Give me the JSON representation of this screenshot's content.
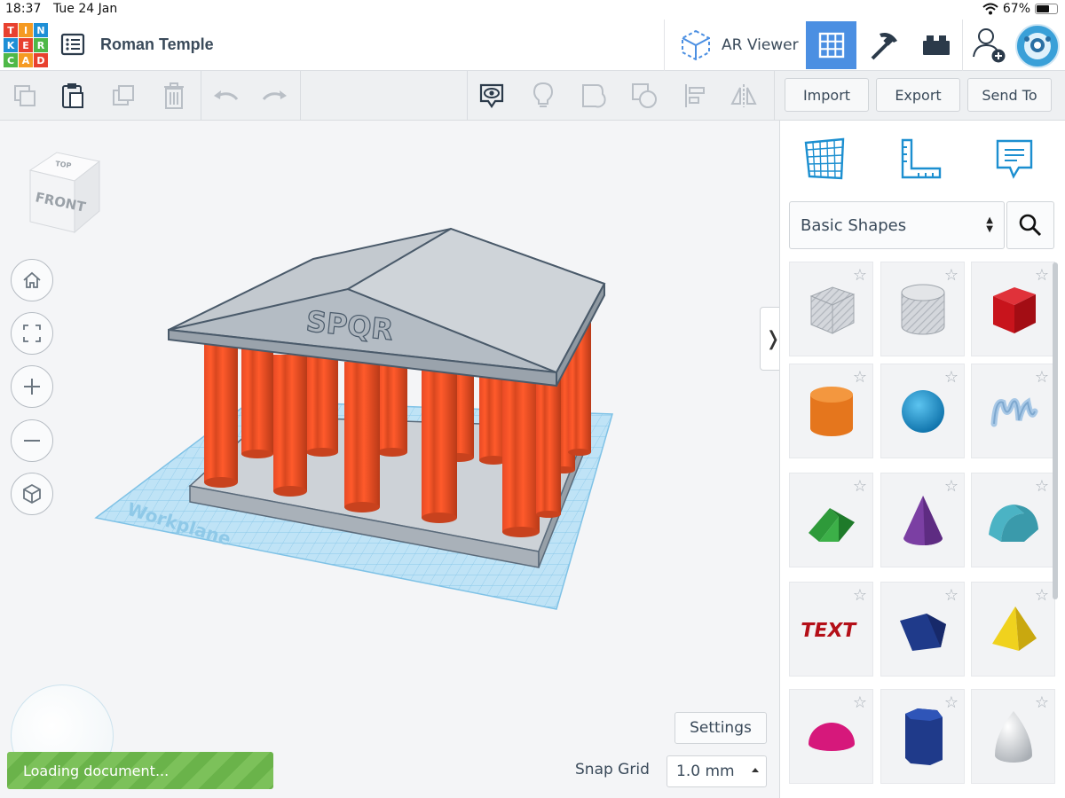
{
  "status_bar": {
    "time": "18:37",
    "date": "Tue 24 Jan",
    "battery": "67%",
    "battery_level": 0.67
  },
  "logo": {
    "letters": [
      "T",
      "I",
      "N",
      "K",
      "E",
      "R",
      "C",
      "A",
      "D"
    ]
  },
  "header": {
    "doc_title": "Roman Temple",
    "ar_viewer_label": "AR Viewer",
    "views": [
      "3d-design-view-icon",
      "codeblocks-icon",
      "bricks-icon"
    ],
    "active_view": "3d-design-view-icon"
  },
  "toolbar": {
    "tools": [
      "copy-icon",
      "paste-icon",
      "duplicate-icon",
      "delete-icon",
      "undo-icon",
      "redo-icon",
      "notes-icon",
      "bulb-icon",
      "group-icon",
      "ungroup-icon",
      "align-icon",
      "mirror-icon"
    ],
    "import_label": "Import",
    "export_label": "Export",
    "send_to_label": "Send To"
  },
  "canvas": {
    "viewcube": {
      "top_label": "TOP",
      "front_label": "FRONT"
    },
    "nav_buttons": [
      "home-icon",
      "fit-all-icon",
      "zoom-in-icon",
      "zoom-out-icon",
      "ortho-view-icon"
    ],
    "pediment_text": "SPQR",
    "workplane_label": "Workplane",
    "settings_label": "Settings",
    "snap_grid_label": "Snap Grid",
    "snap_grid_value": "1.0 mm",
    "loading_text": "Loading document..."
  },
  "panel": {
    "tabs": [
      "workplane-grid-icon",
      "ruler-icon",
      "notes-icon"
    ],
    "library": "Basic Shapes",
    "shapes": [
      {
        "name": "Box (hole)",
        "color": "#c9ccd2"
      },
      {
        "name": "Cylinder (hole)",
        "color": "#c9ccd2"
      },
      {
        "name": "Box",
        "color": "#d0121b"
      },
      {
        "name": "Cylinder",
        "color": "#e5761d"
      },
      {
        "name": "Sphere",
        "color": "#1592d1"
      },
      {
        "name": "Scribble",
        "color": "#a8c8e6"
      },
      {
        "name": "Roof",
        "color": "#2e9a3a"
      },
      {
        "name": "Cone",
        "color": "#7b3fa3"
      },
      {
        "name": "Round Roof",
        "color": "#4bb3c4"
      },
      {
        "name": "Text",
        "color": "#d0121b"
      },
      {
        "name": "Wedge",
        "color": "#1f3a8a"
      },
      {
        "name": "Pyramid",
        "color": "#e8c81a"
      },
      {
        "name": "Half Sphere",
        "color": "#d6187b"
      },
      {
        "name": "Polygon",
        "color": "#1f3a8a"
      },
      {
        "name": "Paraboloid",
        "color": "#d9dcdf"
      }
    ]
  }
}
